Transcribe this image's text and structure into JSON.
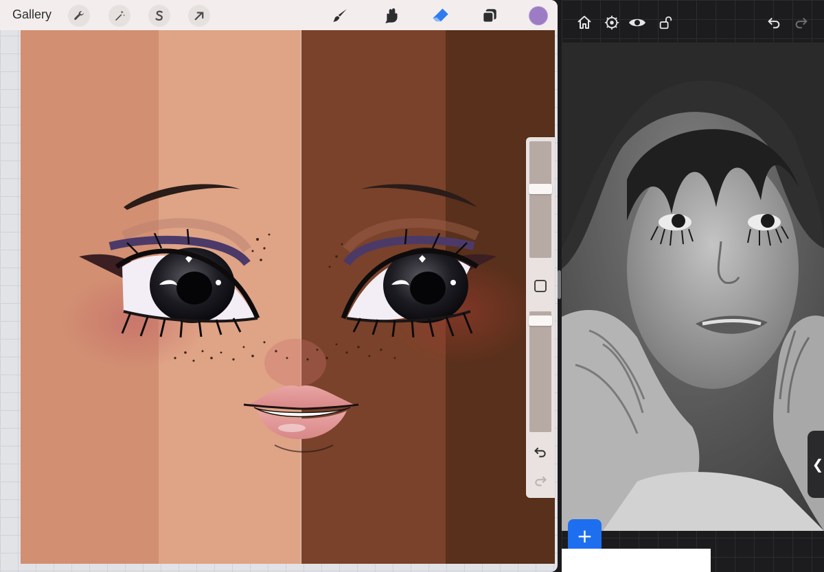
{
  "left_app": {
    "topbar": {
      "gallery_label": "Gallery",
      "left_tools": [
        "wrench-icon",
        "magic-wand-icon",
        "selection-s-icon",
        "transform-arrow-icon"
      ],
      "right_tools": [
        "brush-icon",
        "smudge-icon",
        "eraser-icon",
        "layers-icon"
      ],
      "active_tool": "eraser-icon",
      "active_tool_color": "#2f7cf0",
      "current_color": "#9c7cc4"
    },
    "canvas": {
      "skin_tones": [
        "#d28f72",
        "#dfa386",
        "#7a422a",
        "#58301b"
      ]
    },
    "sidebar": {
      "brush_size_level": 0.28,
      "opacity_level": 0.04,
      "icons": [
        "modify-square-icon",
        "undo-icon",
        "redo-icon"
      ]
    }
  },
  "right_app": {
    "toolbar_icons": [
      "home-icon",
      "settings-gear-icon",
      "eye-icon",
      "unlock-icon",
      "undo-icon",
      "redo-icon"
    ],
    "add_button_label": "+",
    "collapse_label": "❮",
    "accent_color": "#1e6ff0"
  }
}
